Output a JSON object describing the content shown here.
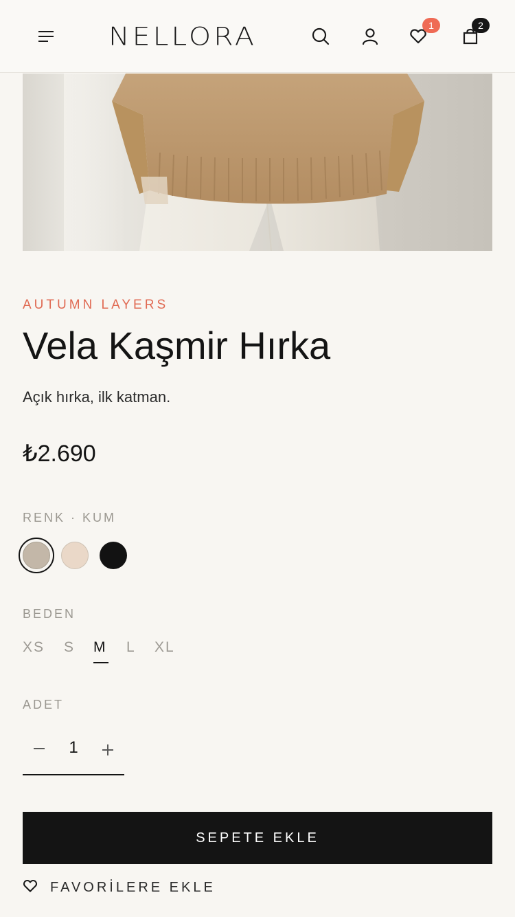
{
  "header": {
    "logo": "NELLORA",
    "wishlist_count": "1",
    "cart_count": "2"
  },
  "product": {
    "eyebrow": "AUTUMN LAYERS",
    "title": "Vela Kaşmir Hırka",
    "subtitle": "Açık hırka, ilk katman.",
    "price": "₺2.690"
  },
  "color": {
    "label": "RENK · KUM",
    "swatches": [
      {
        "name": "Kum",
        "hex": "#c3b7a8",
        "selected": true
      },
      {
        "name": "Bej",
        "hex": "#ead8c8",
        "selected": false
      },
      {
        "name": "Siyah",
        "hex": "#121212",
        "selected": false
      }
    ]
  },
  "size": {
    "label": "BEDEN",
    "options": [
      "XS",
      "S",
      "M",
      "L",
      "XL"
    ],
    "selected": "M"
  },
  "quantity": {
    "label": "ADET",
    "value": "1"
  },
  "actions": {
    "add_to_cart": "SEPETE EKLE",
    "add_to_favorites": "FAVORİLERE EKLE"
  },
  "colors": {
    "accent": "#e06a53",
    "badge_wishlist": "#ef6b55",
    "dark": "#141414",
    "background": "#f8f6f2"
  }
}
